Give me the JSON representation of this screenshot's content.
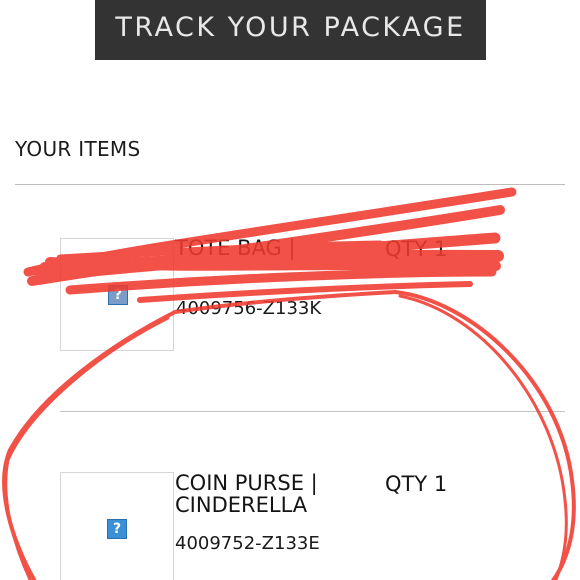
{
  "header": {
    "track_label": "TRACK YOUR PACKAGE"
  },
  "items_section": {
    "title": "YOUR ITEMS",
    "items": [
      {
        "name": "TOTE BAG |",
        "qty": "QTY 1",
        "sku": "4009756-Z133K"
      },
      {
        "name": "COIN PURSE | CINDERELLA",
        "qty": "QTY 1",
        "sku": "4009752-Z133E"
      }
    ],
    "image_placeholder_glyph": "?"
  },
  "annotations": {
    "scribble_color": "#f03a2e"
  }
}
